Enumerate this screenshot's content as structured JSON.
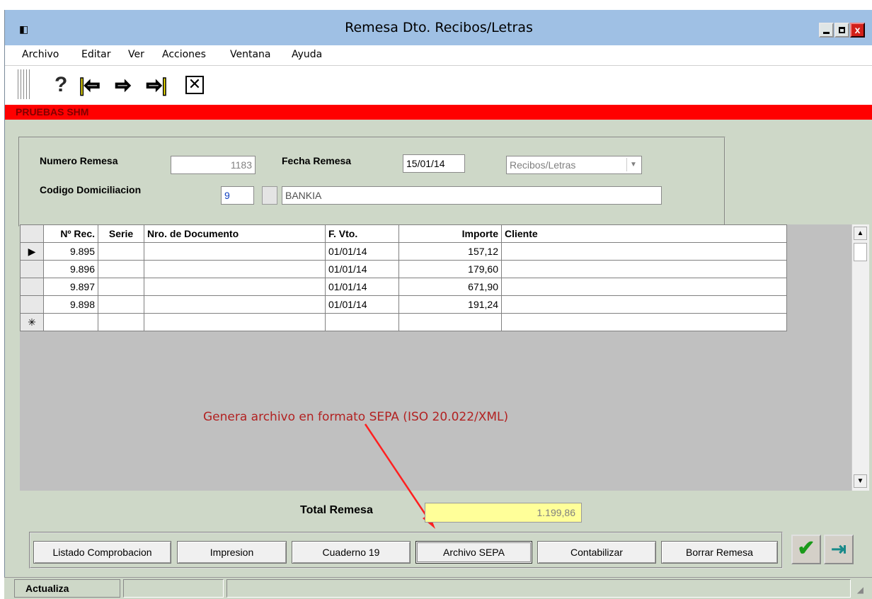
{
  "window": {
    "title": "Remesa Dto. Recibos/Letras",
    "app_icon": "form-icon",
    "close_glyph": "x"
  },
  "menu": [
    "Archivo",
    "Editar",
    "Ver",
    "Acciones",
    "Ventana",
    "Ayuda"
  ],
  "toolbar": {
    "help": "?",
    "first": "|⇦",
    "next": "⇨",
    "last": "⇨|",
    "close": "✕"
  },
  "company_banner": "PRUEBAS SHM",
  "header": {
    "numero_remesa_label": "Numero Remesa",
    "numero_remesa_value": "1183",
    "fecha_remesa_label": "Fecha Remesa",
    "fecha_remesa_value": "15/01/14",
    "tipo_value": "Recibos/Letras",
    "codigo_domiciliacion_label": "Codigo Domiciliacion",
    "codigo_domiciliacion_value": "9",
    "banco_value": "BANKIA"
  },
  "grid": {
    "columns": [
      "Nº Rec.",
      "Serie",
      "Nro. de Documento",
      "F. Vto.",
      "Importe",
      "Cliente"
    ],
    "rows": [
      {
        "marker": "▶",
        "nrec": "9.895",
        "serie": "",
        "documento": "",
        "fvto": "01/01/14",
        "importe": "157,12",
        "cliente": ""
      },
      {
        "marker": "",
        "nrec": "9.896",
        "serie": "",
        "documento": "",
        "fvto": "01/01/14",
        "importe": "179,60",
        "cliente": ""
      },
      {
        "marker": "",
        "nrec": "9.897",
        "serie": "",
        "documento": "",
        "fvto": "01/01/14",
        "importe": "671,90",
        "cliente": ""
      },
      {
        "marker": "",
        "nrec": "9.898",
        "serie": "",
        "documento": "",
        "fvto": "01/01/14",
        "importe": "191,24",
        "cliente": ""
      }
    ],
    "new_row_marker": "✳"
  },
  "annotation": "Genera archivo en formato SEPA (ISO 20.022/XML)",
  "total": {
    "label": "Total Remesa",
    "value": "1.199,86"
  },
  "buttons": {
    "listado": "Listado Comprobacion",
    "impresion": "Impresion",
    "cuaderno": "Cuaderno 19",
    "sepa": "Archivo SEPA",
    "contabilizar": "Contabilizar",
    "borrar": "Borrar Remesa"
  },
  "status": {
    "first": "Actualiza",
    "second": "",
    "third": ""
  },
  "colors": {
    "banner": "#ff0000",
    "banner_text": "#800000",
    "annotation": "#b22222",
    "total_bg": "#ffff99",
    "titlebar": "#9fc0e4",
    "window_bg": "#ced8c8"
  }
}
